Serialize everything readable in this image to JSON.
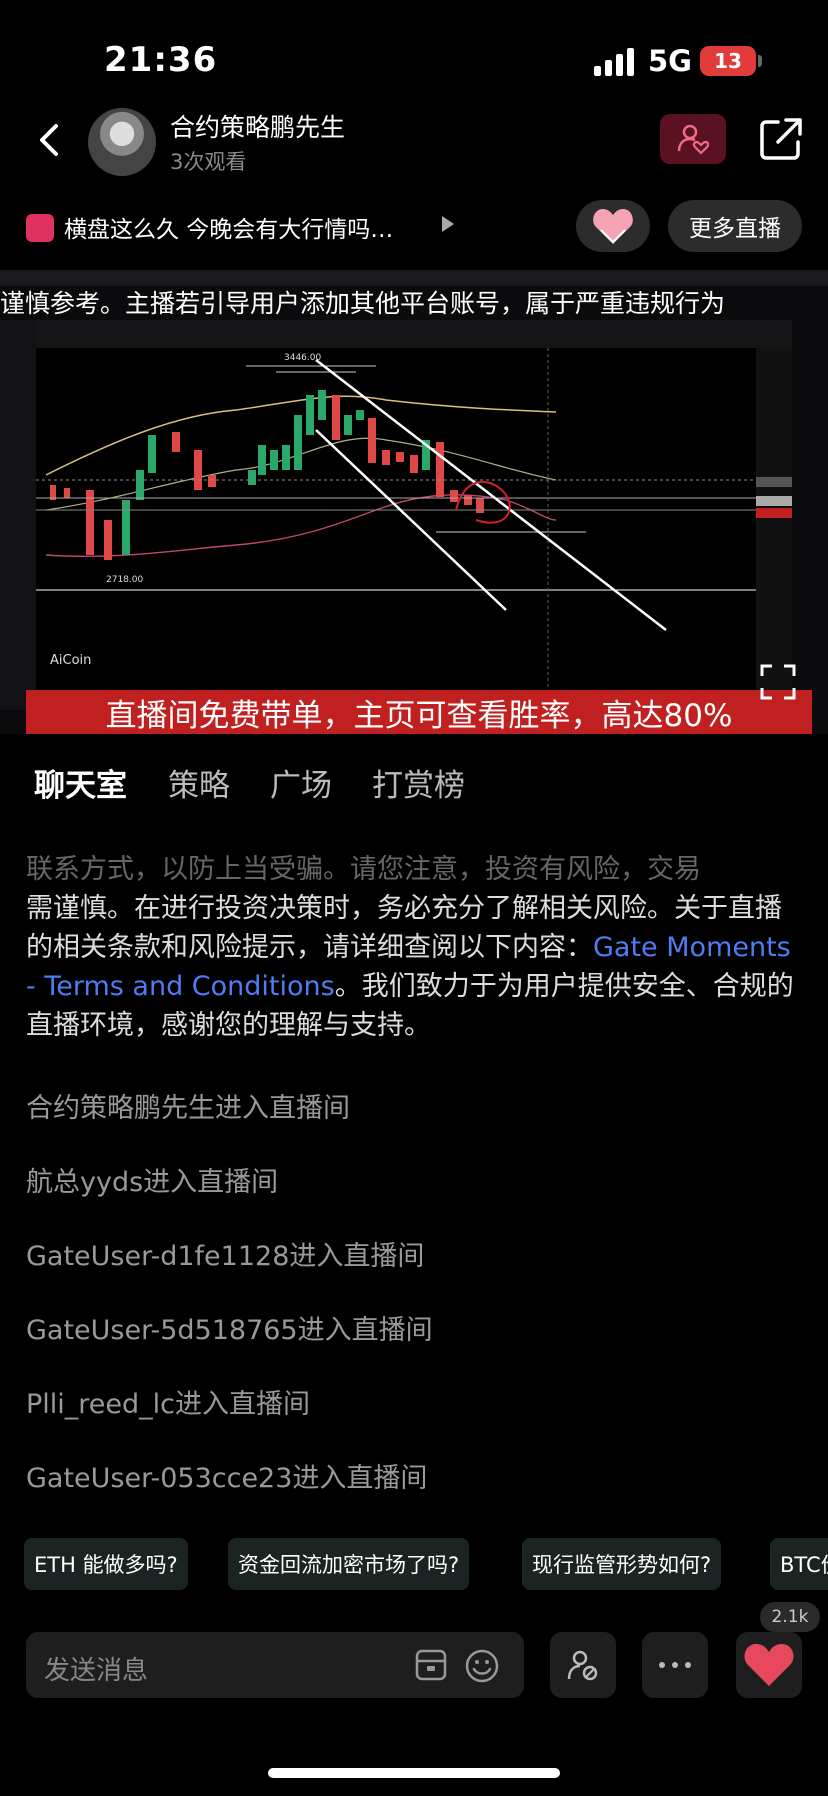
{
  "status_bar": {
    "time": "21:36",
    "network": "5G",
    "battery": "13"
  },
  "header": {
    "host_name": "合约策略鹏先生",
    "views": "3次观看"
  },
  "topic": {
    "text": "横盘这么久 今晚会有大行情吗…"
  },
  "buttons": {
    "more_live": "更多直播"
  },
  "video": {
    "marquee": "谨慎参考。主播若引导用户添加其他平台账号，属于严重违规行为",
    "banner": "直播间免费带单，主页可查看胜率，高达80%",
    "watermark": "AiCoin",
    "chart_labels": {
      "high": "3446.00",
      "low": "2718.00"
    }
  },
  "tabs": [
    "聊天室",
    "策略",
    "广场",
    "打赏榜"
  ],
  "notice": {
    "faded_line": "联系方式，以防上当受骗。请您注意，投资有风险，交易",
    "text1": "需谨慎。在进行投资决策时，务必充分了解相关风险。关于直播的相关条款和风险提示，请详细查阅以下内容：",
    "link": "Gate Moments - Terms and Conditions",
    "text2": "。我们致力于为用户提供安全、合规的直播环境，感谢您的理解与支持。"
  },
  "entries": [
    "合约策略鹏先生进入直播间",
    "航总yyds进入直播间",
    "GateUser-d1fe1128进入直播间",
    "GateUser-5d518765进入直播间",
    "Plli_reed_lc进入直播间",
    "GateUser-053cce23进入直播间"
  ],
  "quick_questions": [
    "ETH 能做多吗?",
    "资金回流加密市场了吗?",
    "现行监管形势如何?",
    "BTC价"
  ],
  "bottom": {
    "placeholder": "发送消息",
    "likes": "2.1k"
  }
}
